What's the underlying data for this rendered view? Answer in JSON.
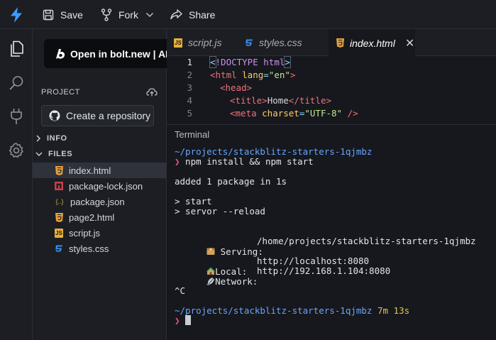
{
  "toolbar": {
    "save_label": "Save",
    "fork_label": "Fork",
    "share_label": "Share"
  },
  "sidebar": {
    "banner_text": "Open in bolt.new | AI",
    "project_header": "PROJECT",
    "create_repo_label": "Create a repository",
    "sections": [
      {
        "label": "INFO",
        "expanded": false
      },
      {
        "label": "FILES",
        "expanded": true
      }
    ],
    "files": [
      {
        "name": "index.html",
        "icon": "html-icon",
        "active": true
      },
      {
        "name": "package-lock.json",
        "icon": "npm-icon",
        "active": false
      },
      {
        "name": "package.json",
        "icon": "json-icon",
        "active": false
      },
      {
        "name": "page2.html",
        "icon": "html-icon",
        "active": false
      },
      {
        "name": "script.js",
        "icon": "js-icon",
        "active": false
      },
      {
        "name": "styles.css",
        "icon": "css-icon",
        "active": false
      }
    ]
  },
  "tabs": [
    {
      "label": "script.js",
      "icon": "js-icon",
      "active": false
    },
    {
      "label": "styles.css",
      "icon": "css-icon",
      "active": false
    },
    {
      "label": "index.html",
      "icon": "html-icon",
      "active": true
    }
  ],
  "editor": {
    "line_numbers": [
      "1",
      "2",
      "3",
      "4",
      "5"
    ],
    "lines": {
      "l1_open": "<",
      "l1_doctype": "!DOCTYPE html",
      "l1_close": ">",
      "l2_tag": "<html ",
      "l2_attr": "lang",
      "l2_eq": "=",
      "l2_val": "\"en\"",
      "l2_close": ">",
      "l3": "<head>",
      "l4_open": "<title>",
      "l4_text": "Home",
      "l4_close": "</title>",
      "l5_tag": "<meta ",
      "l5_attr": "charset",
      "l5_eq": "=",
      "l5_val": "\"UTF-8\"",
      "l5_close": " />"
    }
  },
  "terminal": {
    "title": "Terminal",
    "path1": "~/projects/stackblitz-starters-1qjmbz",
    "prompt_symbol": "❯",
    "command": " npm install && npm start",
    "added": "added 1 package in 1s",
    "start1": "> start",
    "start2": "> servor --reload",
    "serving_label": " Serving:",
    "serving_value": "/home/projects/stackblitz-starters-1qjmbz",
    "local_label": "Local:",
    "local_value": "http://localhost:8080",
    "network_label": "Network:",
    "network_value": "http://192.168.1.104:8080",
    "ctrl_c": "^C",
    "path2": "~/projects/stackblitz-starters-1qjmbz",
    "elapsed": " 7m 13s"
  },
  "colors": {
    "accent_bolt": "#3b9cff",
    "html_icon": "#e7a03c",
    "js_icon": "#e9b03a",
    "css_icon": "#3a8fe8",
    "npm_icon": "#c9404a"
  }
}
